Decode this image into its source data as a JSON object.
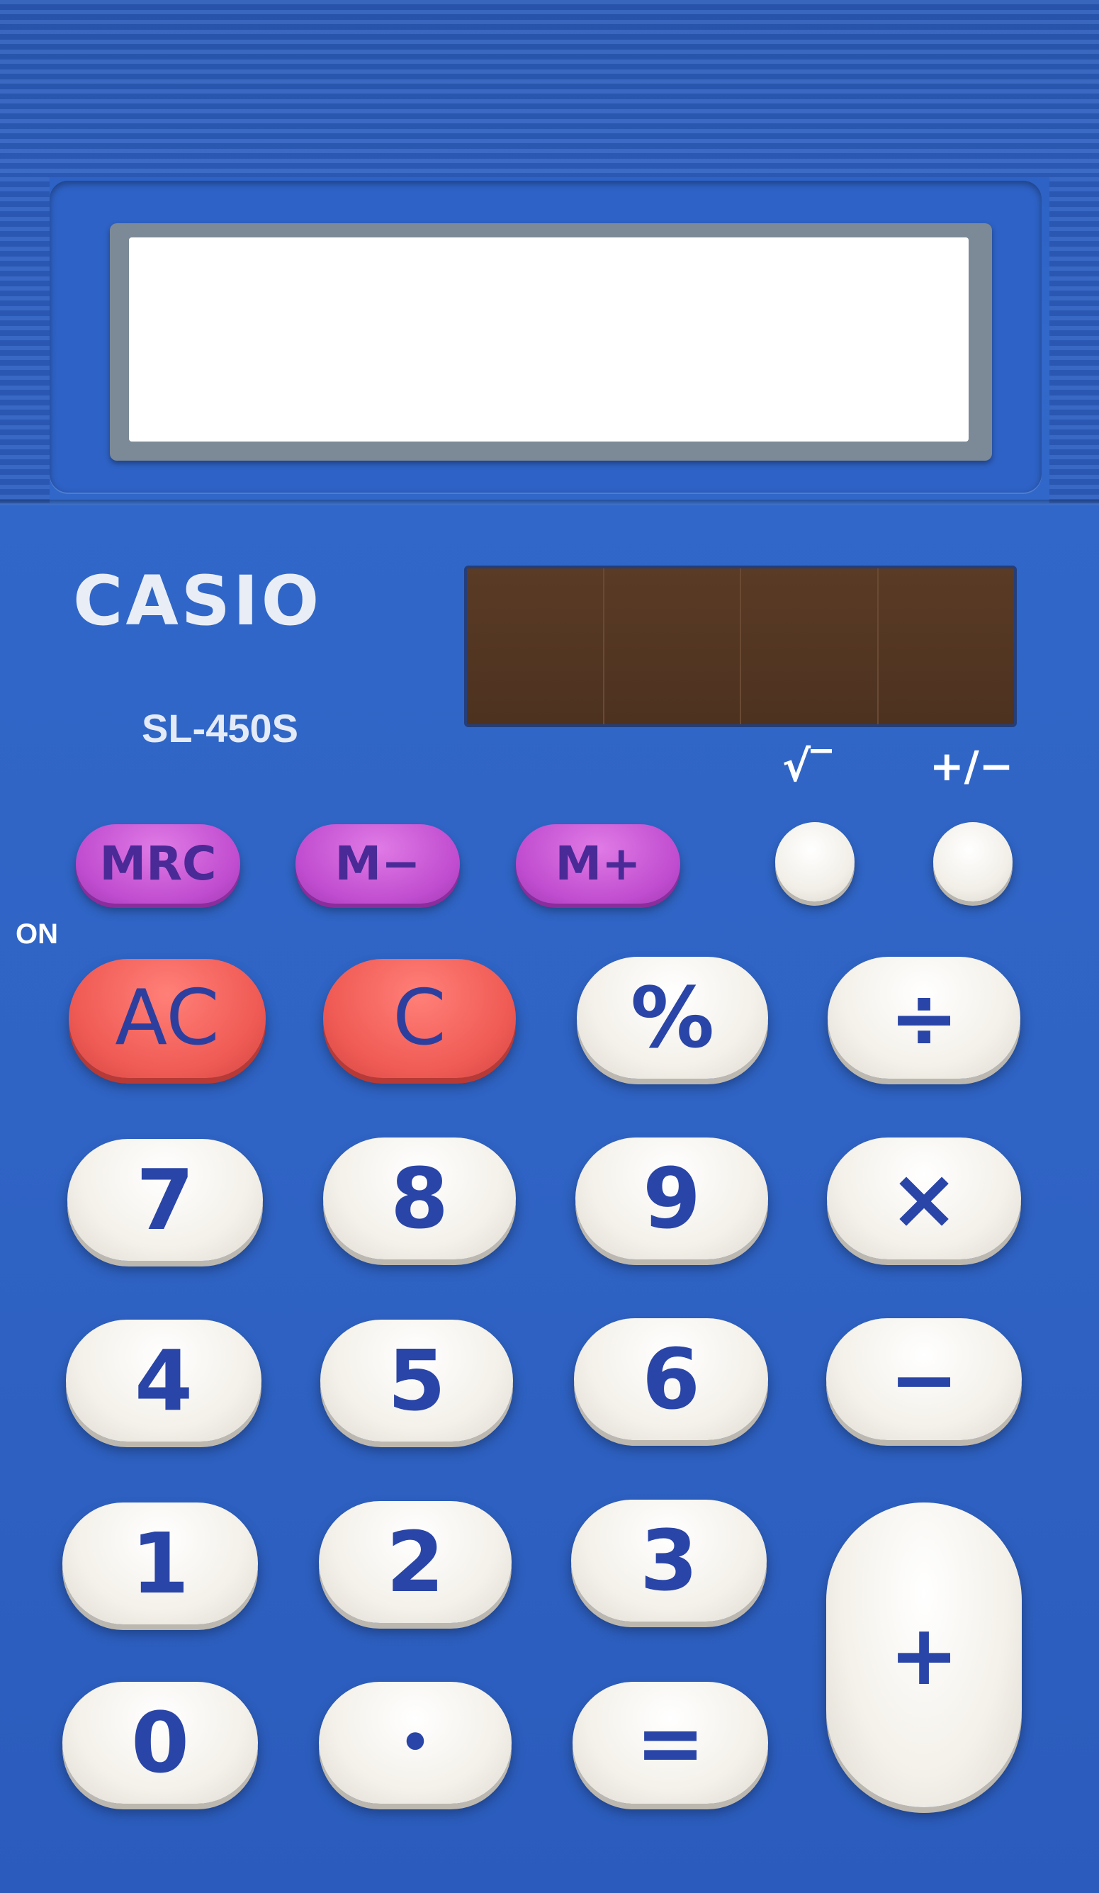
{
  "brand": "CASIO",
  "model": "SL-450S",
  "labels": {
    "sqrt": "√‾",
    "plus_minus": "+/−",
    "on": "ON"
  },
  "memory_keys": [
    "MRC",
    "M−",
    "M+"
  ],
  "keys": {
    "ac": "AC",
    "c": "C",
    "percent": "%",
    "divide": "÷",
    "seven": "7",
    "eight": "8",
    "nine": "9",
    "multiply": "×",
    "four": "4",
    "five": "5",
    "six": "6",
    "minus": "−",
    "one": "1",
    "two": "2",
    "three": "3",
    "plus": "+",
    "zero": "0",
    "dot": "•",
    "equals": "="
  },
  "colors": {
    "body": "#2f62c3",
    "memory_key": "#c04ccf",
    "clear_key": "#f05b55",
    "number_key": "#f4f1ea",
    "key_text": "#2a45a8",
    "solar_panel": "#5a3b25"
  }
}
